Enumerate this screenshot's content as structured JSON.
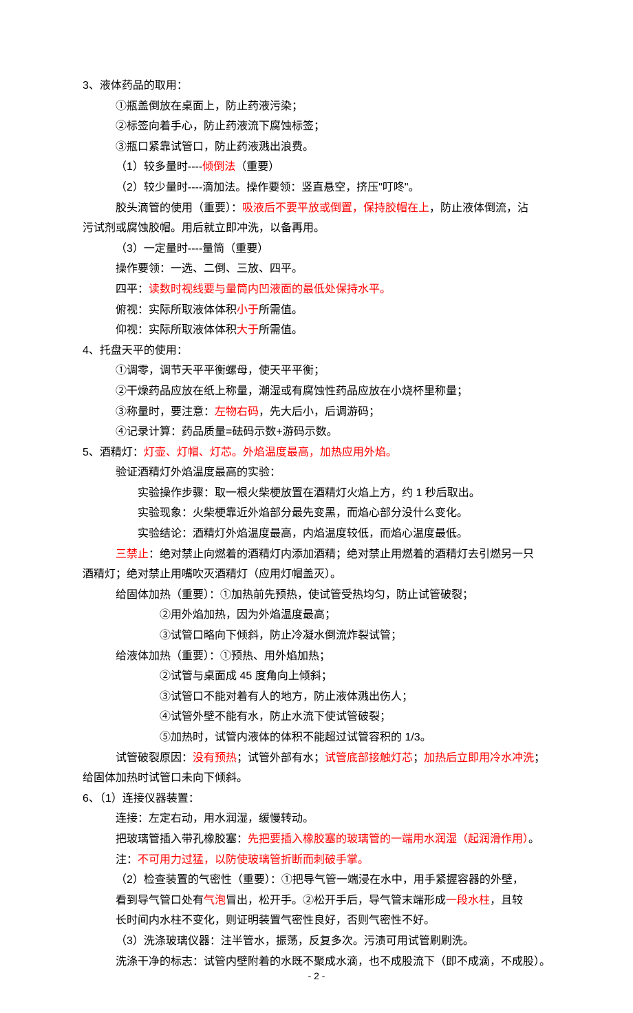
{
  "s3": {
    "head": {
      "pre": "3、液体药品的取用：",
      "hp": []
    },
    "l1": {
      "pre": "①瓶盖倒放在桌面上，防止药液污染；",
      "hp": []
    },
    "l2": {
      "pre": "②标签向着手心，防止药液流下腐蚀标签；",
      "hp": []
    },
    "l3": {
      "pre": "③瓶口紧靠试管口，防止药液溅出浪费。",
      "hp": []
    },
    "l4": {
      "pre": "（1）较多量时----",
      "p": [
        {
          "t": "倾倒法",
          "r": 1
        },
        {
          "t": "（重要）"
        }
      ]
    },
    "l5": {
      "pre": "（2）较少量时----滴加法。操作要领：竖直悬空，挤压\"叮咚\"。",
      "hp": []
    },
    "l6a": {
      "pre": "胶头滴管的使用（重要）：",
      "p": [
        {
          "t": "吸液后不要平放或倒置，保持胶帽在上",
          "r": 1
        },
        {
          "t": "，防止液体倒流，沾"
        }
      ]
    },
    "l6b": {
      "pre": "污试剂或腐蚀胶帽。用后就立即冲洗，以备再用。",
      "hp": []
    },
    "l7": {
      "pre": "（3）一定量时----量筒（重要）",
      "hp": []
    },
    "l8": {
      "pre": "操作要领：一选、二倒、三放、四平。",
      "hp": []
    },
    "l9": {
      "pre": "四平：",
      "p": [
        {
          "t": "读数时视线要与量筒内凹液面的最低处保持水平。",
          "r": 1
        }
      ]
    },
    "l10": {
      "pre": "俯视：实际所取液体体积",
      "p": [
        {
          "t": "小于",
          "r": 1
        },
        {
          "t": "所需值。"
        }
      ]
    },
    "l11": {
      "pre": "仰视：实际所取液体体积",
      "p": [
        {
          "t": "大于",
          "r": 1
        },
        {
          "t": "所需值。"
        }
      ]
    }
  },
  "s4": {
    "head": {
      "pre": "4、托盘天平的使用：",
      "hp": []
    },
    "l1": {
      "pre": "①调零，调节天平平衡螺母，使天平平衡；",
      "hp": []
    },
    "l2": {
      "pre": "②干燥药品应放在纸上称量，潮湿或有腐蚀性药品应放在小烧杯里称量；",
      "hp": []
    },
    "l3": {
      "pre": "③称量时，要注意：",
      "p": [
        {
          "t": "左物右码",
          "r": 1
        },
        {
          "t": "，先大后小，后调游码；"
        }
      ]
    },
    "l4": {
      "pre": "④记录计算：药品质量=砝码示数+游码示数。",
      "hp": []
    }
  },
  "s5": {
    "head": {
      "pre": "5、酒精灯：",
      "p": [
        {
          "t": "灯壶、灯帽、灯芯。外焰温度最高，加热应用外焰。",
          "r": 1
        }
      ]
    },
    "l1": {
      "pre": "验证酒精灯外焰温度最高的实验：",
      "hp": []
    },
    "l2": {
      "pre": "实验操作步骤：取一根火柴梗放置在酒精灯火焰上方，约 1 秒后取出。",
      "hp": []
    },
    "l3": {
      "pre": "实验现象：火柴梗靠近外焰部分最先变黑，而焰心部分没什么变化。",
      "hp": []
    },
    "l4": {
      "pre": "实验结论：酒精灯外焰温度最高，内焰温度较低，而焰心温度最低。",
      "hp": []
    },
    "l5a": {
      "pre": "",
      "p": [
        {
          "t": "三禁止",
          "r": 1
        },
        {
          "t": "：绝对禁止向燃着的酒精灯内添加酒精；绝对禁止用燃着的酒精灯去引燃另一只"
        }
      ]
    },
    "l5b": {
      "pre": "酒精灯；绝对禁止用嘴吹灭酒精灯（应用灯帽盖灭）。",
      "hp": []
    },
    "g1": {
      "pre": "给固体加热（重要）：①加热前先预热，使试管受热均匀，防止试管破裂；",
      "hp": []
    },
    "g2": {
      "pre": "②用外焰加热，因为外焰温度最高；",
      "hp": []
    },
    "g3": {
      "pre": "③试管口略向下倾斜，防止冷凝水倒流炸裂试管；",
      "hp": []
    },
    "h1": {
      "pre": "给液体加热（重要）：①预热、用外焰加热；",
      "hp": []
    },
    "h2": {
      "pre": "②试管与桌面成 45 度角向上倾斜；",
      "hp": []
    },
    "h3": {
      "pre": "③试管口不能对着有人的地方，防止液体溅出伤人；",
      "hp": []
    },
    "h4": {
      "pre": "④试管外壁不能有水，防止水流下使试管破裂；",
      "hp": []
    },
    "h5": {
      "pre": "⑤加热时，试管内液体的体积不能超过试管容积的 1/3。",
      "hp": []
    },
    "r1a": {
      "pre": "试管破裂原因：",
      "p": [
        {
          "t": "没有预热",
          "r": 1
        },
        {
          "t": "；试管外部有水；"
        },
        {
          "t": "试管底部接触灯芯",
          "r": 1
        },
        {
          "t": "；"
        },
        {
          "t": "加热后立即用冷水冲洗",
          "r": 1
        },
        {
          "t": "；"
        }
      ]
    },
    "r1b": {
      "pre": "给固体加热时试管口未向下倾斜。",
      "hp": []
    }
  },
  "s6": {
    "head": {
      "pre": "6、（1）连接仪器装置：",
      "hp": []
    },
    "l1": {
      "pre": "连接：左定右动，用水润湿，缓慢转动。",
      "hp": []
    },
    "l2": {
      "pre": "把玻璃管插入带孔橡胶塞：",
      "p": [
        {
          "t": "先把要插入橡胶塞的玻璃管的一端用水润湿（起润滑作用）",
          "r": 1
        },
        {
          "t": "。"
        }
      ]
    },
    "l3": {
      "pre": "注：",
      "p": [
        {
          "t": "不可用力过猛，以防使玻璃管折断而刺破手掌。",
          "r": 1
        }
      ]
    },
    "l4": {
      "pre": "（2）检查装置的气密性（重要）：①把导气管一端浸在水中，用手紧握容器的外壁，",
      "hp": []
    },
    "l5": {
      "pre": "看到导气管口处有",
      "p": [
        {
          "t": "气泡",
          "r": 1
        },
        {
          "t": "冒出，松开手。②松开手后，导气管末端形成"
        },
        {
          "t": "一段水柱",
          "r": 1
        },
        {
          "t": "，且较"
        }
      ]
    },
    "l6": {
      "pre": "长时间内水柱不变化，则证明装置气密性良好，否则气密性不好。",
      "hp": []
    },
    "l7": {
      "pre": "（3）洗涤玻璃仪器：注半管水，振荡，反复多次。污渍可用试管刷刷洗。",
      "hp": []
    },
    "l8": {
      "pre": "洗涤干净的标志：试管内壁附着的水既不聚成水滴，也不成股流下（即不成滴，不成股）。",
      "hp": []
    }
  },
  "footer": "- 2 -"
}
